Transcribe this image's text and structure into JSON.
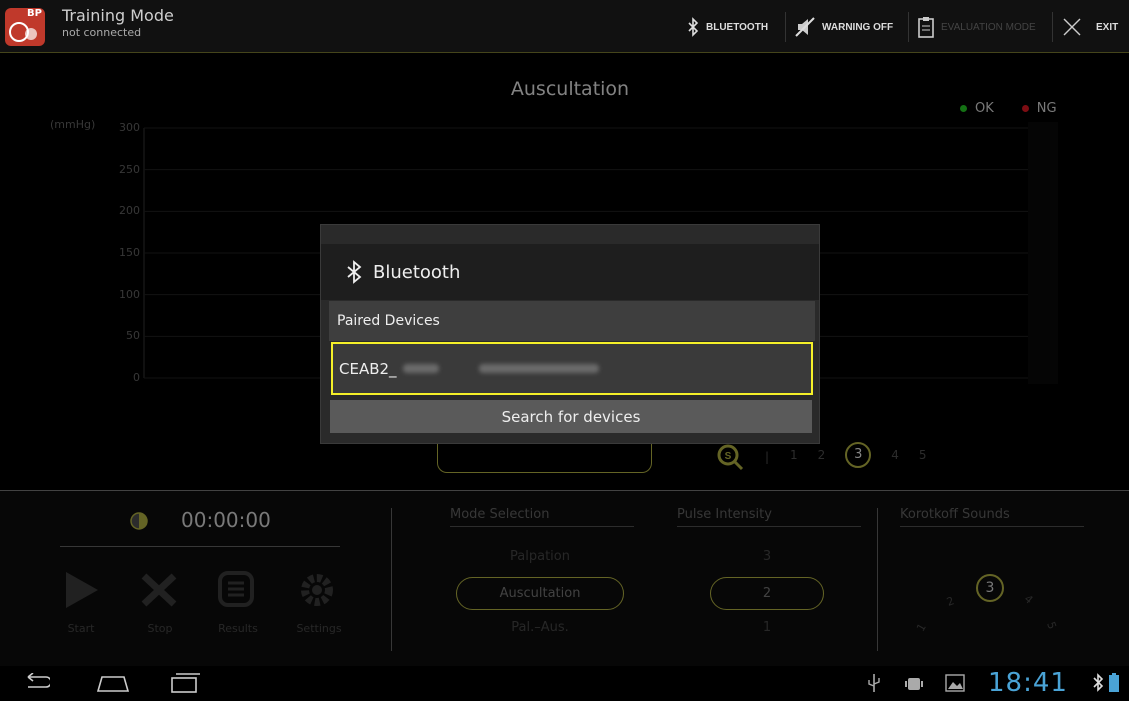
{
  "topbar": {
    "app_badge": "BP",
    "title": "Training Mode",
    "subtitle": "not connected",
    "bluetooth_label": "BLUETOOTH",
    "warning_label": "WARNING OFF",
    "evaluation_label": "EVALUATION MODE",
    "exit_label": "EXIT"
  },
  "chart": {
    "title": "Auscultation",
    "unit": "(mmHg)",
    "legend": [
      {
        "label": "OK",
        "color": "#1fae1f"
      },
      {
        "label": "NG",
        "color": "#c0141e"
      }
    ]
  },
  "chart_data": {
    "type": "line",
    "title": "Auscultation",
    "ylabel": "(mmHg)",
    "ylim": [
      0,
      300
    ],
    "yticks": [
      "300",
      "250",
      "200",
      "150",
      "100",
      "50",
      "0"
    ],
    "series": []
  },
  "pager": {
    "pages": [
      "1",
      "2",
      "3",
      "4",
      "5"
    ],
    "current": "3"
  },
  "timer": {
    "value": "00:00:00"
  },
  "controls": [
    "Start",
    "Stop",
    "Results",
    "Settings"
  ],
  "mode_selection": {
    "heading": "Mode Selection",
    "options": [
      "Palpation",
      "Auscultation",
      "Pal.–Aus."
    ],
    "selected": "Auscultation"
  },
  "pulse_intensity": {
    "heading": "Pulse Intensity",
    "options": [
      "3",
      "2",
      "1"
    ],
    "selected": "2"
  },
  "korotkoff": {
    "heading": "Korotkoff Sounds",
    "selected": "3",
    "dial": [
      "2",
      "4",
      "1",
      "5"
    ]
  },
  "dialog": {
    "title": "Bluetooth",
    "paired_heading": "Paired Devices",
    "device_name": "CEAB2_",
    "search_label": "Search for devices"
  },
  "statusbar": {
    "time": "18:41"
  },
  "colors": {
    "accent": "#9a9a3a",
    "highlight": "#f5f029",
    "clock": "#4aa3d6",
    "ok": "#1fae1f",
    "ng": "#c0141e"
  }
}
